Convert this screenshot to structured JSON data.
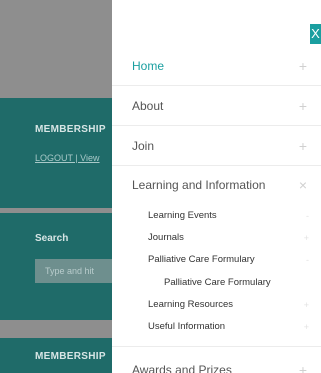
{
  "background": {
    "membership_title": "MEMBERSHIP",
    "membership_links": "LOGOUT | View",
    "search_label": "Search",
    "search_placeholder": "Type and hit",
    "membership_title_2": "MEMBERSHIP"
  },
  "menu": {
    "close_label": "X",
    "items": [
      {
        "label": "Home",
        "toggle": "+",
        "active": true
      },
      {
        "label": "About",
        "toggle": "+"
      },
      {
        "label": "Join",
        "toggle": "+"
      },
      {
        "label": "Learning and Information",
        "toggle": "×"
      },
      {
        "label": "Awards and Prizes",
        "toggle": "+"
      }
    ],
    "sub_items": [
      {
        "label": "Learning Events",
        "toggle": "-"
      },
      {
        "label": "Journals",
        "toggle": "+"
      },
      {
        "label": "Palliative Care Formulary",
        "toggle": "-"
      },
      {
        "label": "Palliative Care Formulary",
        "toggle": ""
      },
      {
        "label": "Learning Resources",
        "toggle": "+"
      },
      {
        "label": "Useful Information",
        "toggle": "+"
      }
    ]
  },
  "colors": {
    "accent": "#1a9fa0",
    "panel_bg": "#1f6b69"
  }
}
